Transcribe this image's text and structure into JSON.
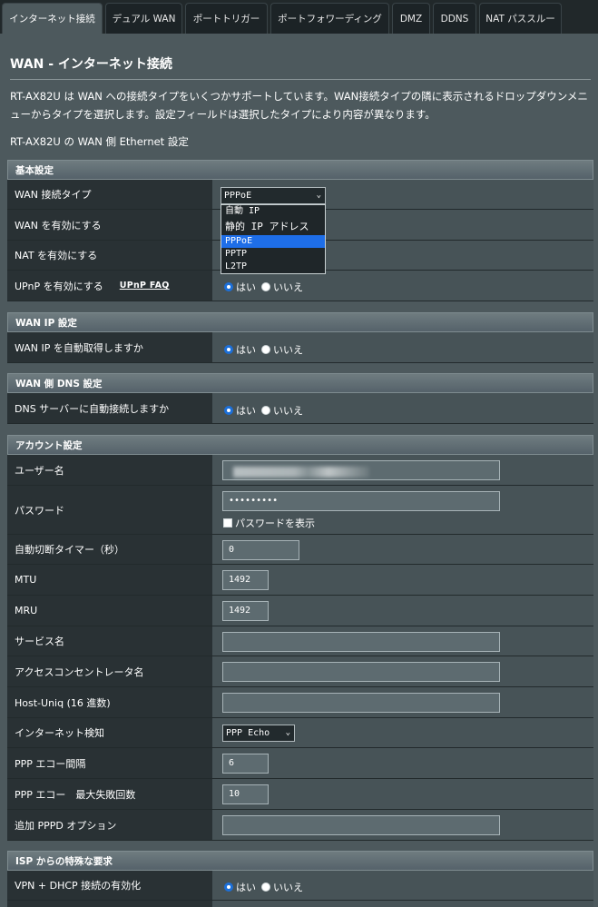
{
  "tabs": [
    "インターネット接続",
    "デュアル WAN",
    "ポートトリガー",
    "ポートフォワーディング",
    "DMZ",
    "DDNS",
    "NAT パススルー"
  ],
  "page": {
    "title": "WAN - インターネット接続",
    "description": "RT-AX82U は WAN への接続タイプをいくつかサポートしています。WAN接続タイプの隣に表示されるドロップダウンメニューからタイプを選択します。設定フィールドは選択したタイプにより内容が異なります。",
    "subtitle": "RT-AX82U の WAN 側 Ethernet 設定"
  },
  "common": {
    "yes": "はい",
    "no": "いいえ"
  },
  "basic": {
    "header": "基本設定",
    "wan_type_label": "WAN 接続タイプ",
    "wan_type_value": "PPPoE",
    "wan_type_options": [
      "自動 IP",
      "静的 IP アドレス",
      "PPPoE",
      "PPTP",
      "L2TP"
    ],
    "enable_wan_label": "WAN を有効にする",
    "enable_nat_label": "NAT を有効にする",
    "enable_upnp_label": "UPnP を有効にする",
    "upnp_faq": "UPnP FAQ"
  },
  "wan_ip": {
    "header": "WAN IP 設定",
    "auto_ip_label": "WAN IP を自動取得しますか"
  },
  "wan_dns": {
    "header": "WAN 側 DNS 設定",
    "auto_dns_label": "DNS サーバーに自動接続しますか"
  },
  "account": {
    "header": "アカウント設定",
    "username_label": "ユーザー名",
    "password_label": "パスワード",
    "password_value": "•••••••••",
    "show_password": "パスワードを表示",
    "idle_label": "自動切断タイマー（秒）",
    "idle_value": "0",
    "mtu_label": "MTU",
    "mtu_value": "1492",
    "mru_label": "MRU",
    "mru_value": "1492",
    "service_label": "サービス名",
    "ac_label": "アクセスコンセントレータ名",
    "hostuniq_label": "Host-Uniq (16 進数)",
    "detect_label": "インターネット検知",
    "detect_value": "PPP Echo",
    "echo_interval_label": "PPP エコー間隔",
    "echo_interval_value": "6",
    "echo_fail_label": "PPP エコー　最大失敗回数",
    "echo_fail_value": "10",
    "pppd_label": "追加 PPPD オプション"
  },
  "isp": {
    "header": "ISP からの特殊な要求",
    "vpn_dhcp_label": "VPN + DHCP 接続の有効化"
  }
}
